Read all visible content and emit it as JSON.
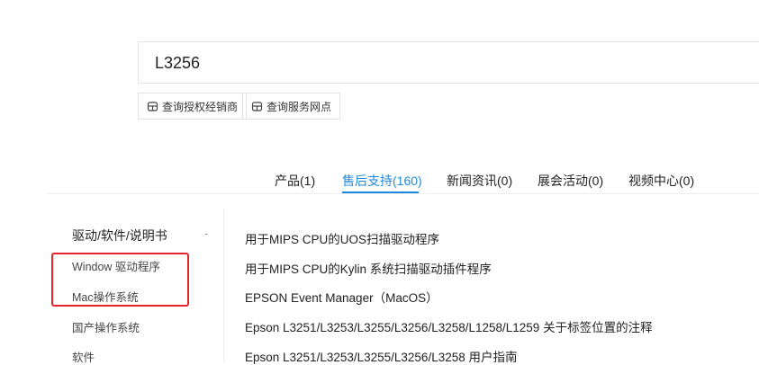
{
  "search": {
    "value": "L3256"
  },
  "links": [
    {
      "label": "查询授权经销商",
      "icon": "store-icon"
    },
    {
      "label": "查询服务网点",
      "icon": "store-icon"
    }
  ],
  "tabs": [
    {
      "label": "产品(1)",
      "active": false
    },
    {
      "label": "售后支持(160)",
      "active": true
    },
    {
      "label": "新闻资讯(0)",
      "active": false
    },
    {
      "label": "展会活动(0)",
      "active": false
    },
    {
      "label": "视频中心(0)",
      "active": false
    }
  ],
  "colors": {
    "accent": "#1f8ad9",
    "highlight": "#e8232a"
  },
  "sidebar": {
    "title": "驱动/软件/说明书",
    "collapse_symbol": "-",
    "items": [
      {
        "label": "Window 驱动程序"
      },
      {
        "label": "Mac操作系统"
      },
      {
        "label": "国产操作系统"
      },
      {
        "label": "软件"
      }
    ]
  },
  "results": [
    {
      "title": "用于MIPS CPU的UOS扫描驱动程序"
    },
    {
      "title": "用于MIPS CPU的Kylin 系统扫描驱动插件程序"
    },
    {
      "title": "EPSON Event Manager（MacOS）"
    },
    {
      "title": "Epson L3251/L3253/L3255/L3256/L3258/L1258/L1259 关于标签位置的注释"
    },
    {
      "title": "Epson L3251/L3253/L3255/L3256/L3258 用户指南"
    }
  ]
}
